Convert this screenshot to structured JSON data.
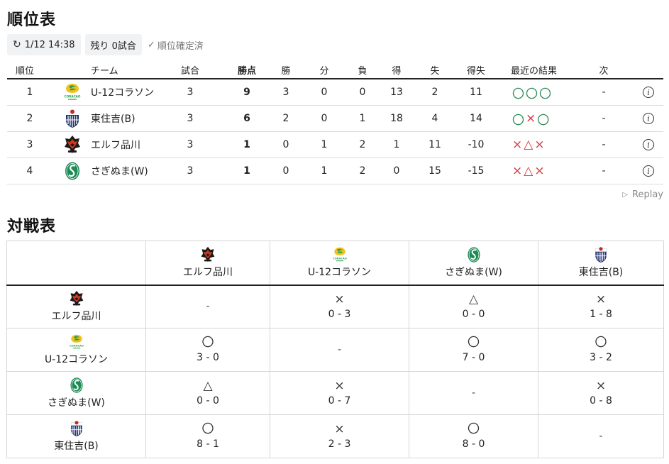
{
  "standings": {
    "title": "順位表",
    "updated_at": "1/12 14:38",
    "remaining": "残り 0試合",
    "status": "順位確定済",
    "headers": {
      "rank": "順位",
      "team": "チーム",
      "played": "試合",
      "points": "勝点",
      "win": "勝",
      "draw": "分",
      "loss": "負",
      "goals_for": "得",
      "goals_against": "失",
      "goal_diff": "得失",
      "recent": "最近の結果",
      "next": "次"
    },
    "rows": [
      {
        "rank": "1",
        "team": "U-12コラソン",
        "logo": "coracao",
        "played": "3",
        "points": "9",
        "win": "3",
        "draw": "0",
        "loss": "0",
        "gf": "13",
        "ga": "2",
        "gd": "11",
        "recent": [
          "〇",
          "〇",
          "〇"
        ],
        "next": "-"
      },
      {
        "rank": "2",
        "team": "東住吉(B)",
        "logo": "higashisumiyoshi",
        "played": "3",
        "points": "6",
        "win": "2",
        "draw": "0",
        "loss": "1",
        "gf": "18",
        "ga": "4",
        "gd": "14",
        "recent": [
          "〇",
          "×",
          "〇"
        ],
        "next": "-"
      },
      {
        "rank": "3",
        "team": "エルフ品川",
        "logo": "elf",
        "played": "3",
        "points": "1",
        "win": "0",
        "draw": "1",
        "loss": "2",
        "gf": "1",
        "ga": "11",
        "gd": "-10",
        "recent": [
          "×",
          "△",
          "×"
        ],
        "next": "-"
      },
      {
        "rank": "4",
        "team": "さぎぬま(W)",
        "logo": "saginuma",
        "played": "3",
        "points": "1",
        "win": "0",
        "draw": "1",
        "loss": "2",
        "gf": "0",
        "ga": "15",
        "gd": "-15",
        "recent": [
          "×",
          "△",
          "×"
        ],
        "next": "-"
      }
    ],
    "replay_label": "Replay"
  },
  "matrix": {
    "title": "対戦表",
    "columns": [
      {
        "team": "エルフ品川",
        "logo": "elf"
      },
      {
        "team": "U-12コラソン",
        "logo": "coracao"
      },
      {
        "team": "さぎぬま(W)",
        "logo": "saginuma"
      },
      {
        "team": "東住吉(B)",
        "logo": "higashisumiyoshi"
      }
    ],
    "rows": [
      {
        "team": "エルフ品川",
        "logo": "elf",
        "cells": [
          {
            "mark": "",
            "score": "-"
          },
          {
            "mark": "×",
            "score": "0 - 3"
          },
          {
            "mark": "△",
            "score": "0 - 0"
          },
          {
            "mark": "×",
            "score": "1 - 8"
          }
        ]
      },
      {
        "team": "U-12コラソン",
        "logo": "coracao",
        "cells": [
          {
            "mark": "〇",
            "score": "3 - 0"
          },
          {
            "mark": "",
            "score": "-"
          },
          {
            "mark": "〇",
            "score": "7 - 0"
          },
          {
            "mark": "〇",
            "score": "3 - 2"
          }
        ]
      },
      {
        "team": "さぎぬま(W)",
        "logo": "saginuma",
        "cells": [
          {
            "mark": "△",
            "score": "0 - 0"
          },
          {
            "mark": "×",
            "score": "0 - 7"
          },
          {
            "mark": "",
            "score": "-"
          },
          {
            "mark": "×",
            "score": "0 - 8"
          }
        ]
      },
      {
        "team": "東住吉(B)",
        "logo": "higashisumiyoshi",
        "cells": [
          {
            "mark": "〇",
            "score": "8 - 1"
          },
          {
            "mark": "×",
            "score": "2 - 3"
          },
          {
            "mark": "〇",
            "score": "8 - 0"
          },
          {
            "mark": "",
            "score": "-"
          }
        ]
      }
    ]
  },
  "colors": {
    "win": "#2e8b57",
    "loss": "#d9363e",
    "draw": "#d9363e"
  },
  "icons": {
    "refresh": "refresh-icon",
    "check": "check-icon",
    "info": "info-icon",
    "replay": "play-triangle-icon"
  }
}
